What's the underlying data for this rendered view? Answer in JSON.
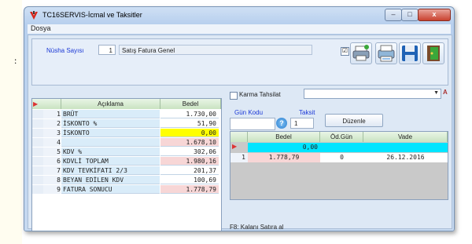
{
  "window": {
    "title": "TC16SERVIS-İcmal ve Taksitler"
  },
  "window_controls": {
    "minimize": "–",
    "maximize": "□",
    "close": "x"
  },
  "menu": {
    "file": "Dosya"
  },
  "top": {
    "nusha_label": "Nüsha Sayısı",
    "nusha_value": "1",
    "fatura_field": "Satış Fatura Genel"
  },
  "toolbar": {
    "checkbox_checked": "☑",
    "icons": [
      "printer-icon",
      "print-preview-icon",
      "save-icon",
      "exit-icon"
    ]
  },
  "left_grid": {
    "headers": {
      "desc": "Açıklama",
      "value": "Bedel"
    },
    "rows": [
      {
        "no": "1",
        "desc": "BRÜT",
        "value": "1.730,00"
      },
      {
        "no": "2",
        "desc": "İSKONTO %",
        "value": "51,90"
      },
      {
        "no": "3",
        "desc": "İSKONTO",
        "value": "0,00"
      },
      {
        "no": "4",
        "desc": "",
        "value": "1.678,10"
      },
      {
        "no": "5",
        "desc": "KDV %",
        "value": "302,06"
      },
      {
        "no": "6",
        "desc": "KDVLİ TOPLAM",
        "value": "1.980,16"
      },
      {
        "no": "7",
        "desc": "KDV TEVKİFATI 2/3",
        "value": "201,37"
      },
      {
        "no": "8",
        "desc": "BEYAN EDİLEN KDV",
        "value": "100,69"
      },
      {
        "no": "9",
        "desc": "FATURA SONUCU",
        "value": "1.778,79"
      }
    ],
    "scroll_label": "III"
  },
  "right": {
    "karma_label": "Karma Tahsilat",
    "az_icon": "A",
    "gun_kodu_label": "Gün Kodu",
    "taksit_label": "Taksit",
    "taksit_value": "1",
    "help_icon": "?",
    "duzenle_label": "Düzenle",
    "grid_headers": {
      "bedel": "Bedel",
      "odgun": "Öd.Gün",
      "vade": "Vade"
    },
    "summary_value": "0,00",
    "rows": [
      {
        "no": "1",
        "bedel": "1.778,79",
        "odgun": "0",
        "vade": "26.12.2016"
      }
    ],
    "status": "F8: Kalanı Satıra al"
  },
  "colors": {
    "accent_yellow": "#ffff00",
    "cyan_row": "#00e5ff",
    "pink_cell": "#f7d6d6",
    "green_header": "#c9e3c1"
  }
}
